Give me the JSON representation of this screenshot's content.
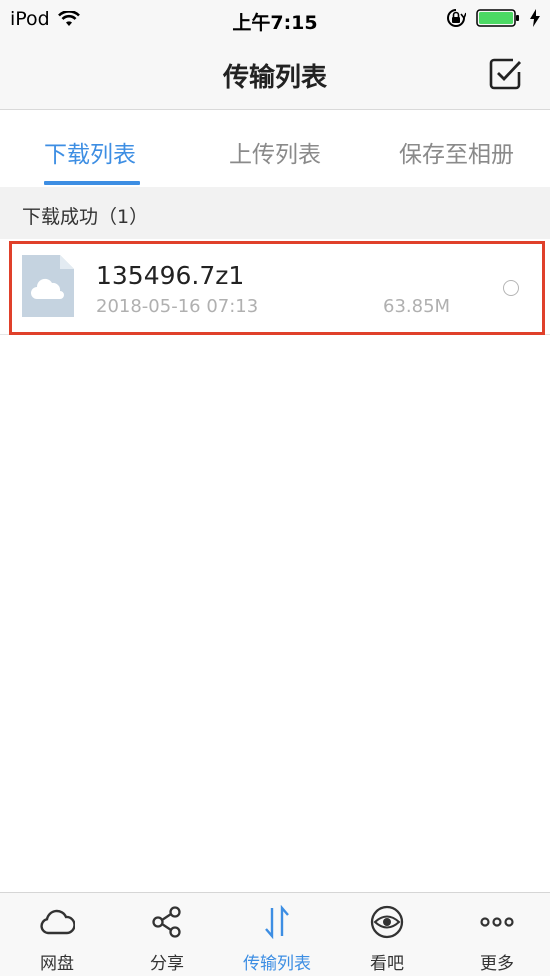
{
  "status_bar": {
    "device": "iPod",
    "time": "上午7:15"
  },
  "nav": {
    "title": "传输列表",
    "select_icon": "checkbox-icon"
  },
  "tabs": [
    {
      "label": "下载列表",
      "active": true
    },
    {
      "label": "上传列表",
      "active": false
    },
    {
      "label": "保存至相册",
      "active": false
    }
  ],
  "section": {
    "label": "下载成功（1）"
  },
  "files": [
    {
      "name": "135496.7z1",
      "date": "2018-05-16 07:13",
      "size": "63.85M",
      "icon": "cloud-file-icon"
    }
  ],
  "tabbar": [
    {
      "label": "网盘",
      "icon": "cloud-icon",
      "active": false
    },
    {
      "label": "分享",
      "icon": "share-icon",
      "active": false
    },
    {
      "label": "传输列表",
      "icon": "transfer-icon",
      "active": true
    },
    {
      "label": "看吧",
      "icon": "eye-icon",
      "active": false
    },
    {
      "label": "更多",
      "icon": "more-icon",
      "active": false
    }
  ],
  "colors": {
    "accent": "#3d8ee3",
    "highlight": "#e0402a",
    "battery": "#4cd964"
  }
}
